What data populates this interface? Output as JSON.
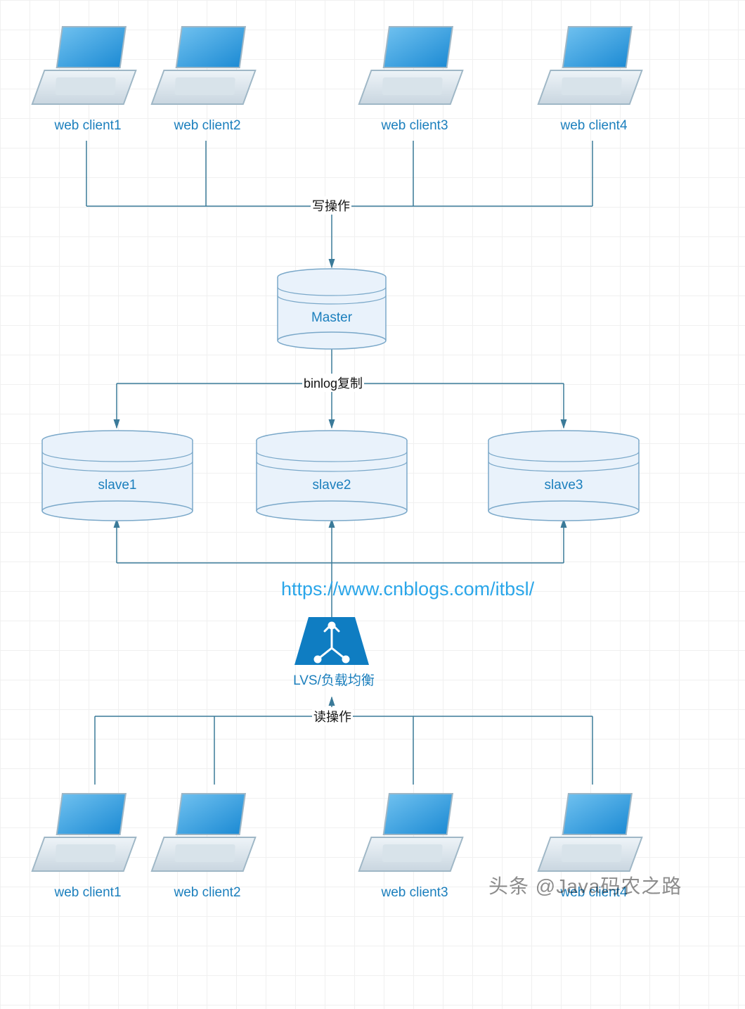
{
  "clients_top": [
    {
      "label": "web client1"
    },
    {
      "label": "web client2"
    },
    {
      "label": "web client3"
    },
    {
      "label": "web client4"
    }
  ],
  "clients_bottom": [
    {
      "label": "web client1"
    },
    {
      "label": "web client2"
    },
    {
      "label": "web client3"
    },
    {
      "label": "web client4"
    }
  ],
  "master": {
    "label": "Master"
  },
  "slaves": [
    {
      "label": "slave1"
    },
    {
      "label": "slave2"
    },
    {
      "label": "slave3"
    }
  ],
  "lvs": {
    "label": "LVS/负载均衡"
  },
  "edges": {
    "write": "写操作",
    "binlog": "binlog复制",
    "read": "读操作"
  },
  "url": "https://www.cnblogs.com/itbsl/",
  "attribution": "头条 @Java码农之路"
}
